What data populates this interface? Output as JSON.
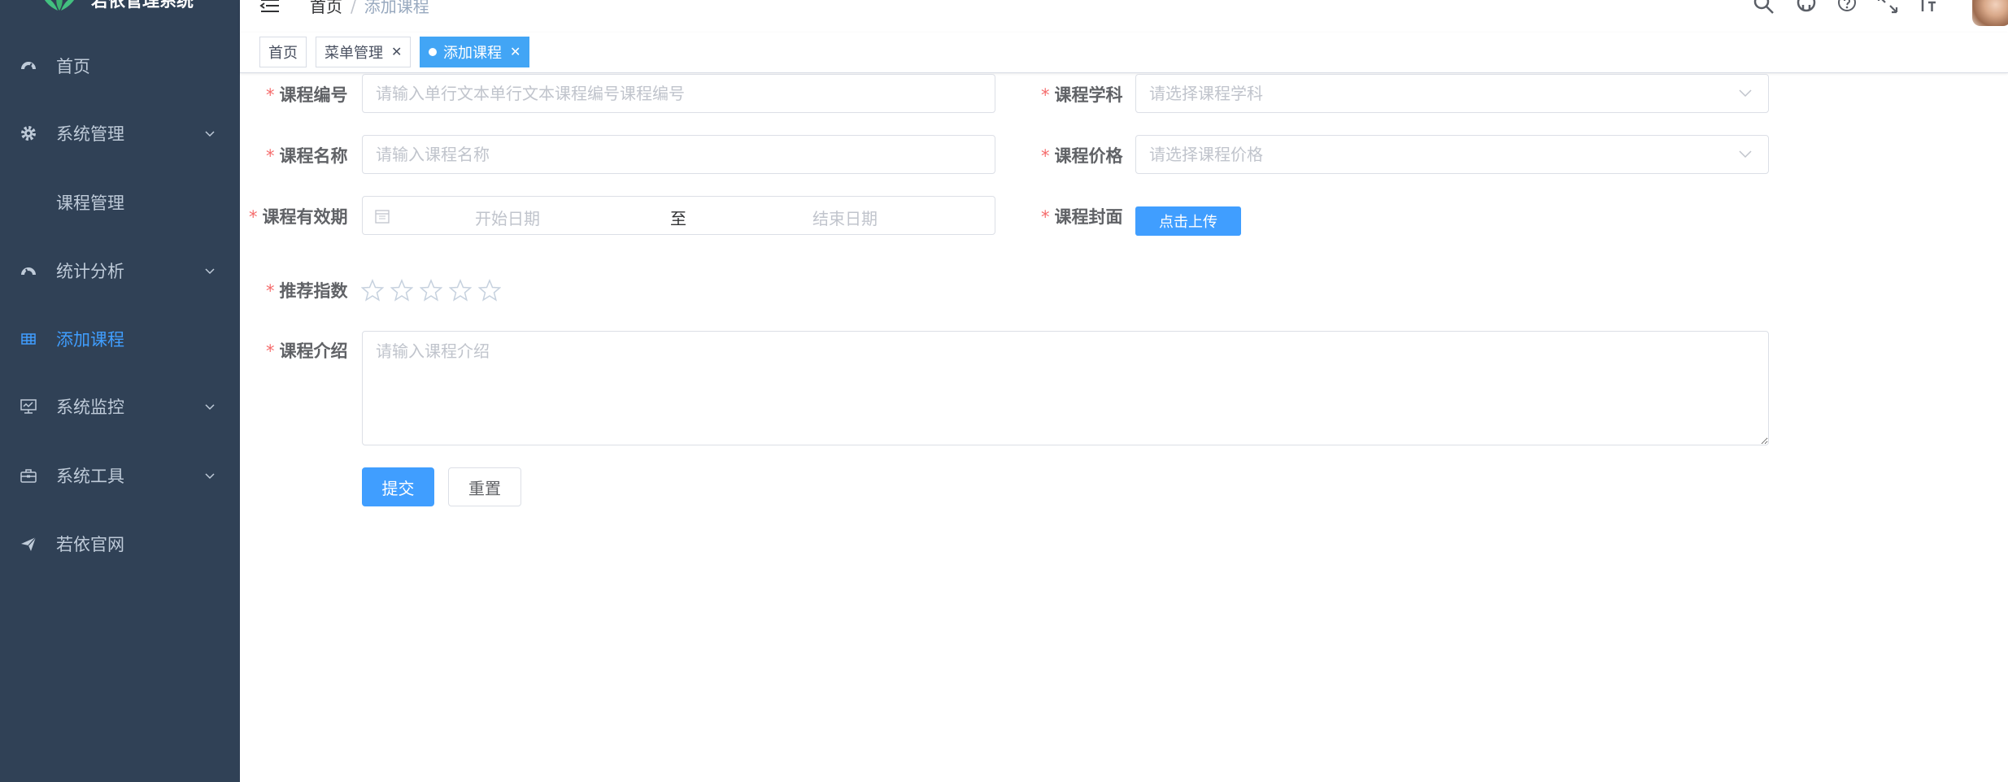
{
  "app": {
    "title": "若依管理系统"
  },
  "sidebar": {
    "items": [
      {
        "label": "首页",
        "icon": "dashboard-icon"
      },
      {
        "label": "系统管理",
        "icon": "gear-icon",
        "has_children": true
      },
      {
        "label": "课程管理",
        "icon": "",
        "sub": true
      },
      {
        "label": "统计分析",
        "icon": "gauge-icon",
        "has_children": true
      },
      {
        "label": "添加课程",
        "icon": "table-icon",
        "active": true
      },
      {
        "label": "系统监控",
        "icon": "monitor-icon",
        "has_children": true
      },
      {
        "label": "系统工具",
        "icon": "toolbox-icon",
        "has_children": true
      },
      {
        "label": "若依官网",
        "icon": "paper-plane-icon"
      }
    ]
  },
  "navbar": {
    "breadcrumb": {
      "home": "首页",
      "separator": "/",
      "current": "添加课程"
    },
    "icons": [
      "search-icon",
      "github-icon",
      "help-icon",
      "fullscreen-icon",
      "font-size-icon"
    ]
  },
  "tags": [
    {
      "label": "首页",
      "closable": false,
      "active": false
    },
    {
      "label": "菜单管理",
      "closable": true,
      "active": false
    },
    {
      "label": "添加课程",
      "closable": true,
      "active": true
    }
  ],
  "form": {
    "required_mark": "*",
    "course_code": {
      "label": "课程编号",
      "placeholder": "请输入单行文本单行文本课程编号课程编号"
    },
    "course_subject": {
      "label": "课程学科",
      "placeholder": "请选择课程学科"
    },
    "course_name": {
      "label": "课程名称",
      "placeholder": "请输入课程名称"
    },
    "course_price": {
      "label": "课程价格",
      "placeholder": "请选择课程价格"
    },
    "course_validity": {
      "label": "课程有效期",
      "start_placeholder": "开始日期",
      "separator": "至",
      "end_placeholder": "结束日期"
    },
    "course_cover": {
      "label": "课程封面",
      "upload_label": "点击上传"
    },
    "recommend_index": {
      "label": "推荐指数",
      "max": 5,
      "value": 0
    },
    "course_intro": {
      "label": "课程介绍",
      "placeholder": "请输入课程介绍"
    },
    "submit_label": "提交",
    "reset_label": "重置"
  },
  "colors": {
    "sidebar_bg": "#304156",
    "sidebar_text": "#bfcbd9",
    "accent": "#409eff",
    "tag_active": "#42a5f5",
    "required": "#f56c6c"
  }
}
